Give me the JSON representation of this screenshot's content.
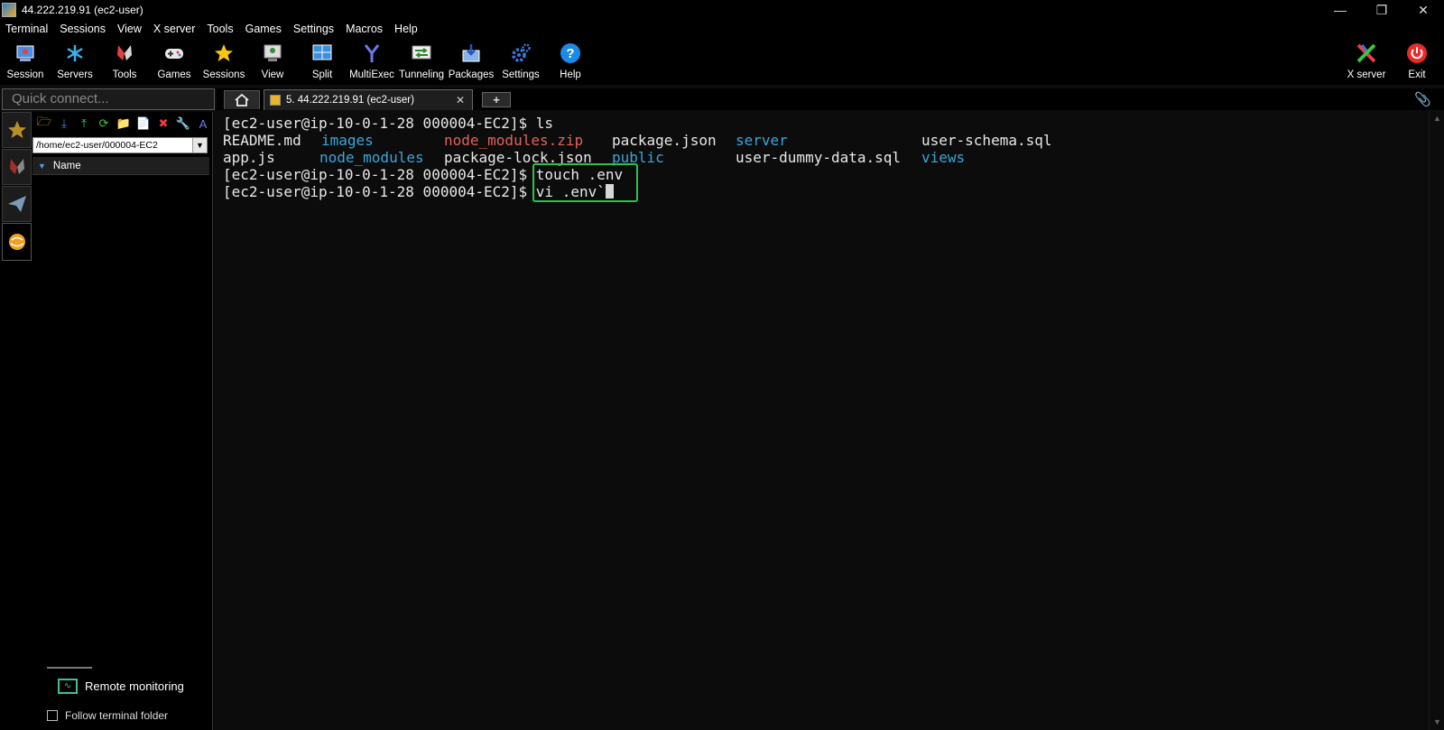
{
  "window": {
    "title": "44.222.219.91 (ec2-user)",
    "minimize": "—",
    "restore": "❐",
    "close": "✕"
  },
  "menu": [
    "Terminal",
    "Sessions",
    "View",
    "X server",
    "Tools",
    "Games",
    "Settings",
    "Macros",
    "Help"
  ],
  "toolbar": {
    "session": "Session",
    "servers": "Servers",
    "tools": "Tools",
    "games": "Games",
    "sessions": "Sessions",
    "view": "View",
    "split": "Split",
    "multiexec": "MultiExec",
    "tunneling": "Tunneling",
    "packages": "Packages",
    "settings": "Settings",
    "help": "Help",
    "xserver": "X server",
    "exit": "Exit"
  },
  "quick_connect": {
    "placeholder": "Quick connect..."
  },
  "tabs": {
    "active_label": "5. 44.222.219.91 (ec2-user)",
    "close": "✕",
    "new": "+"
  },
  "file_panel": {
    "path": "/home/ec2-user/000004-EC2",
    "column_name": "Name",
    "remote_monitoring": "Remote monitoring",
    "follow_folder": "Follow terminal folder"
  },
  "terminal": {
    "prompt": "[ec2-user@ip-10-0-1-28 000004-EC2]$",
    "cmd1": " ls",
    "ls_row1": {
      "c1": "README.md",
      "c2": "images",
      "c3": "node_modules.zip",
      "c4": "package.json",
      "c5": "server",
      "c6": "user-schema.sql"
    },
    "ls_row2": {
      "c1": "app.js",
      "c2": "node_modules",
      "c3": "package-lock.json",
      "c4": "public",
      "c5": "user-dummy-data.sql",
      "c6": "views"
    },
    "cmd2": " touch .env",
    "cmd3": " vi .env`"
  },
  "colors": {
    "directory": "#3aa6d8",
    "archive": "#e2625a",
    "highlight_box": "#2fbf4f",
    "terminal_bg": "#0c0c0c"
  }
}
